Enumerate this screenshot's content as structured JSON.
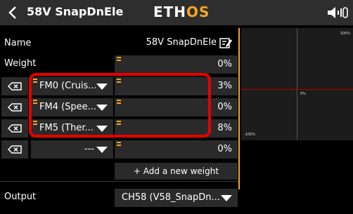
{
  "header": {
    "title": "58V SnapDnEle",
    "logo_main": "ETH",
    "logo_accent": "OS",
    "accent_color": "#f5a623"
  },
  "form": {
    "name_label": "Name",
    "name_value": "58V SnapDnEle",
    "weight_label": "Weight",
    "weight_value": "0%",
    "weights": [
      {
        "source": "FM0 (Cruis...",
        "value": "3%"
      },
      {
        "source": "FM4 (Spee...",
        "value": "0%"
      },
      {
        "source": "FM5 (Ther...",
        "value": "8%"
      },
      {
        "source": "---",
        "value": "0%"
      }
    ],
    "add_weight_label": "+ Add a new weight",
    "output_label": "Output",
    "output_value": "CH58 (V58_SnapDn..."
  },
  "graph": {
    "top_label": "100%",
    "center_label": "0%",
    "bottom_label": "-100%",
    "line_color": "#b30000"
  },
  "icons": {
    "back": "chevron-left-icon",
    "speaker": "speaker-icon",
    "edit": "edit-icon",
    "delete": "delete-icon",
    "dropdown": "caret-down-icon"
  }
}
